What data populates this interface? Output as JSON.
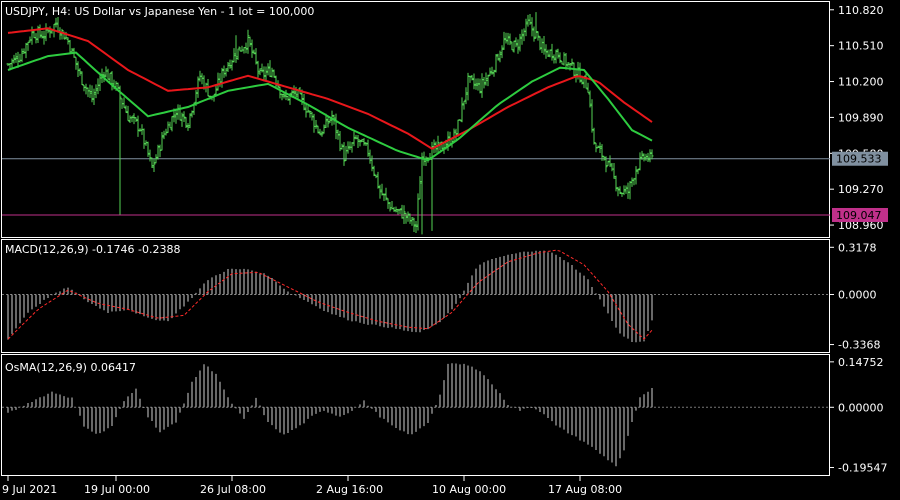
{
  "colors": {
    "background": "#000000",
    "bull": "#55d455",
    "bear": "#55d455",
    "fast_ma": "#2ecc40",
    "slow_ma": "#e8171b",
    "bid_line": "#8090a0",
    "level_line": "#c0308a",
    "histogram": "#d0d0d0",
    "signal": "#ff2a2a",
    "frame": "#ffffff"
  },
  "chart_data": [
    {
      "type": "candlestick",
      "title": "USDJPY, H4:  US Dollar vs Japanese Yen - 1 lot = 100,000",
      "y_ticks": [
        "110.820",
        "110.510",
        "110.200",
        "109.890",
        "109.580",
        "109.270",
        "108.960"
      ],
      "ylim": [
        108.9,
        110.87
      ],
      "price_tags": [
        {
          "label": "109.533",
          "value": 109.533,
          "bg": "#8090a0",
          "fg": "#000000"
        },
        {
          "label": "109.047",
          "value": 109.047,
          "bg": "#c0308a",
          "fg": "#000000"
        }
      ],
      "anchors_close": [
        [
          0,
          110.35
        ],
        [
          6,
          110.42
        ],
        [
          12,
          110.62
        ],
        [
          18,
          110.6
        ],
        [
          24,
          110.7
        ],
        [
          30,
          110.55
        ],
        [
          36,
          110.25
        ],
        [
          42,
          110.05
        ],
        [
          48,
          110.3
        ],
        [
          54,
          110.15
        ],
        [
          60,
          109.9
        ],
        [
          66,
          109.8
        ],
        [
          72,
          109.45
        ],
        [
          78,
          109.75
        ],
        [
          84,
          109.95
        ],
        [
          90,
          109.85
        ],
        [
          96,
          110.25
        ],
        [
          102,
          110.05
        ],
        [
          108,
          110.3
        ],
        [
          114,
          110.45
        ],
        [
          120,
          110.55
        ],
        [
          126,
          110.25
        ],
        [
          132,
          110.3
        ],
        [
          138,
          110.05
        ],
        [
          144,
          110.1
        ],
        [
          150,
          109.95
        ],
        [
          156,
          109.75
        ],
        [
          162,
          109.9
        ],
        [
          168,
          109.55
        ],
        [
          174,
          109.7
        ],
        [
          180,
          109.6
        ],
        [
          186,
          109.25
        ],
        [
          192,
          109.1
        ],
        [
          198,
          109.05
        ],
        [
          204,
          108.95
        ],
        [
          207,
          109.55
        ],
        [
          212,
          109.6
        ],
        [
          218,
          109.65
        ],
        [
          224,
          109.75
        ],
        [
          230,
          110.2
        ],
        [
          236,
          110.15
        ],
        [
          242,
          110.3
        ],
        [
          248,
          110.55
        ],
        [
          254,
          110.5
        ],
        [
          260,
          110.7
        ],
        [
          264,
          110.6
        ],
        [
          268,
          110.45
        ],
        [
          274,
          110.45
        ],
        [
          280,
          110.35
        ],
        [
          286,
          110.25
        ],
        [
          290,
          110.15
        ],
        [
          293,
          109.65
        ],
        [
          298,
          109.55
        ],
        [
          302,
          109.4
        ],
        [
          306,
          109.25
        ],
        [
          310,
          109.25
        ],
        [
          314,
          109.45
        ],
        [
          318,
          109.55
        ],
        [
          322,
          109.53
        ]
      ],
      "fast_ma": [
        [
          0,
          110.3
        ],
        [
          20,
          110.42
        ],
        [
          34,
          110.45
        ],
        [
          50,
          110.2
        ],
        [
          70,
          109.9
        ],
        [
          90,
          109.98
        ],
        [
          110,
          110.12
        ],
        [
          130,
          110.18
        ],
        [
          150,
          110.0
        ],
        [
          170,
          109.8
        ],
        [
          195,
          109.6
        ],
        [
          210,
          109.52
        ],
        [
          225,
          109.7
        ],
        [
          245,
          110.0
        ],
        [
          262,
          110.2
        ],
        [
          276,
          110.32
        ],
        [
          288,
          110.3
        ],
        [
          300,
          110.05
        ],
        [
          312,
          109.78
        ],
        [
          322,
          109.69
        ]
      ],
      "slow_ma": [
        [
          0,
          110.62
        ],
        [
          20,
          110.66
        ],
        [
          40,
          110.55
        ],
        [
          60,
          110.3
        ],
        [
          80,
          110.12
        ],
        [
          100,
          110.15
        ],
        [
          120,
          110.25
        ],
        [
          140,
          110.15
        ],
        [
          160,
          110.05
        ],
        [
          180,
          109.92
        ],
        [
          200,
          109.75
        ],
        [
          212,
          109.62
        ],
        [
          230,
          109.78
        ],
        [
          250,
          109.98
        ],
        [
          270,
          110.15
        ],
        [
          285,
          110.25
        ],
        [
          295,
          110.2
        ],
        [
          308,
          110.02
        ],
        [
          322,
          109.85
        ]
      ]
    },
    {
      "type": "macd",
      "title": "MACD(12,26,9) -0.1746 -0.2388",
      "y_ticks": [
        "0.3178",
        "0.0000",
        "-0.3368"
      ],
      "ylim": [
        -0.36,
        0.34
      ],
      "hist_anchors": [
        [
          0,
          -0.3
        ],
        [
          10,
          -0.12
        ],
        [
          20,
          -0.02
        ],
        [
          30,
          0.05
        ],
        [
          40,
          -0.05
        ],
        [
          50,
          -0.12
        ],
        [
          60,
          -0.1
        ],
        [
          70,
          -0.16
        ],
        [
          80,
          -0.18
        ],
        [
          90,
          -0.05
        ],
        [
          100,
          0.1
        ],
        [
          110,
          0.17
        ],
        [
          120,
          0.17
        ],
        [
          130,
          0.13
        ],
        [
          140,
          0.02
        ],
        [
          150,
          -0.05
        ],
        [
          160,
          -0.12
        ],
        [
          170,
          -0.17
        ],
        [
          180,
          -0.2
        ],
        [
          190,
          -0.22
        ],
        [
          205,
          -0.26
        ],
        [
          215,
          -0.2
        ],
        [
          225,
          -0.05
        ],
        [
          235,
          0.2
        ],
        [
          245,
          0.25
        ],
        [
          255,
          0.28
        ],
        [
          265,
          0.3
        ],
        [
          272,
          0.28
        ],
        [
          280,
          0.22
        ],
        [
          290,
          0.1
        ],
        [
          298,
          -0.08
        ],
        [
          305,
          -0.25
        ],
        [
          312,
          -0.32
        ],
        [
          318,
          -0.32
        ],
        [
          322,
          -0.17
        ]
      ],
      "signal_anchors": [
        [
          0,
          -0.3
        ],
        [
          15,
          -0.1
        ],
        [
          30,
          0.03
        ],
        [
          45,
          -0.06
        ],
        [
          60,
          -0.1
        ],
        [
          75,
          -0.16
        ],
        [
          88,
          -0.14
        ],
        [
          100,
          0.02
        ],
        [
          112,
          0.14
        ],
        [
          125,
          0.15
        ],
        [
          140,
          0.05
        ],
        [
          155,
          -0.05
        ],
        [
          170,
          -0.12
        ],
        [
          185,
          -0.18
        ],
        [
          200,
          -0.22
        ],
        [
          210,
          -0.23
        ],
        [
          222,
          -0.12
        ],
        [
          235,
          0.08
        ],
        [
          250,
          0.22
        ],
        [
          265,
          0.28
        ],
        [
          275,
          0.3
        ],
        [
          288,
          0.2
        ],
        [
          300,
          0.02
        ],
        [
          310,
          -0.2
        ],
        [
          318,
          -0.3
        ],
        [
          322,
          -0.24
        ]
      ]
    },
    {
      "type": "bar",
      "title": "OsMA(12,26,9) 0.06417",
      "y_ticks": [
        "0.14752",
        "0.00000",
        "-0.19547"
      ],
      "ylim": [
        -0.21,
        0.16
      ],
      "hist_anchors": [
        [
          0,
          -0.02
        ],
        [
          12,
          0.02
        ],
        [
          22,
          0.05
        ],
        [
          32,
          0.03
        ],
        [
          38,
          -0.06
        ],
        [
          45,
          -0.09
        ],
        [
          52,
          -0.06
        ],
        [
          58,
          0.02
        ],
        [
          64,
          0.06
        ],
        [
          70,
          -0.03
        ],
        [
          76,
          -0.08
        ],
        [
          84,
          -0.05
        ],
        [
          92,
          0.08
        ],
        [
          98,
          0.14
        ],
        [
          104,
          0.11
        ],
        [
          110,
          0.03
        ],
        [
          118,
          -0.04
        ],
        [
          124,
          0.03
        ],
        [
          130,
          -0.05
        ],
        [
          138,
          -0.09
        ],
        [
          146,
          -0.06
        ],
        [
          152,
          -0.03
        ],
        [
          158,
          -0.01
        ],
        [
          166,
          -0.03
        ],
        [
          172,
          -0.01
        ],
        [
          178,
          0.02
        ],
        [
          186,
          -0.03
        ],
        [
          194,
          -0.07
        ],
        [
          202,
          -0.09
        ],
        [
          210,
          -0.05
        ],
        [
          216,
          0.04
        ],
        [
          220,
          0.14
        ],
        [
          228,
          0.14
        ],
        [
          236,
          0.12
        ],
        [
          244,
          0.06
        ],
        [
          250,
          0.01
        ],
        [
          256,
          -0.01
        ],
        [
          262,
          0.0
        ],
        [
          268,
          -0.02
        ],
        [
          274,
          -0.06
        ],
        [
          282,
          -0.09
        ],
        [
          290,
          -0.12
        ],
        [
          298,
          -0.16
        ],
        [
          304,
          -0.19
        ],
        [
          308,
          -0.14
        ],
        [
          312,
          -0.05
        ],
        [
          316,
          0.03
        ],
        [
          322,
          0.06
        ]
      ]
    }
  ],
  "time_axis": [
    {
      "label": "9 Jul 2021",
      "bar": 0
    },
    {
      "label": "19 Jul 00:00",
      "bar": 54
    },
    {
      "label": "26 Jul 08:00",
      "bar": 112
    },
    {
      "label": "2 Aug 16:00",
      "bar": 170
    },
    {
      "label": "10 Aug 00:00",
      "bar": 228
    },
    {
      "label": "17 Aug 08:00",
      "bar": 286
    }
  ]
}
